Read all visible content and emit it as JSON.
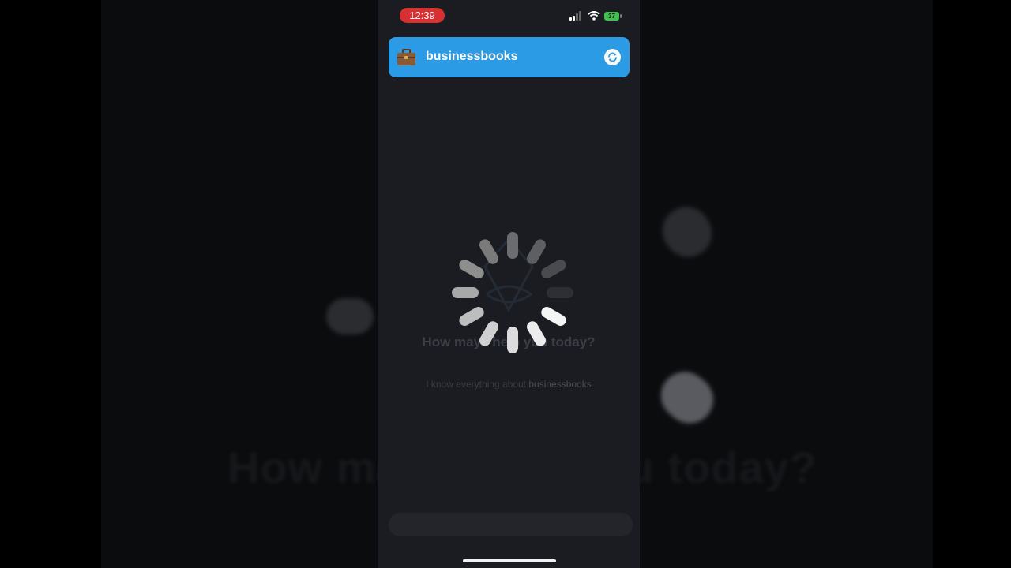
{
  "status_bar": {
    "time": "12:39",
    "battery": "37"
  },
  "header": {
    "title": "businessbooks",
    "icon": "briefcase-icon",
    "refresh_icon": "refresh-icon",
    "color": "#2b9be6"
  },
  "main": {
    "greeting": "How may I help you today?",
    "subtitle_prefix": "I know everything about ",
    "subtitle_brand": "businessbooks",
    "loading_indicator": "spinner-icon"
  },
  "composer": {
    "placeholder": ""
  },
  "colors": {
    "background": "#1b1c21",
    "accent": "#2b9be6",
    "clock_pill": "#d63030",
    "battery": "#3fc24d"
  }
}
